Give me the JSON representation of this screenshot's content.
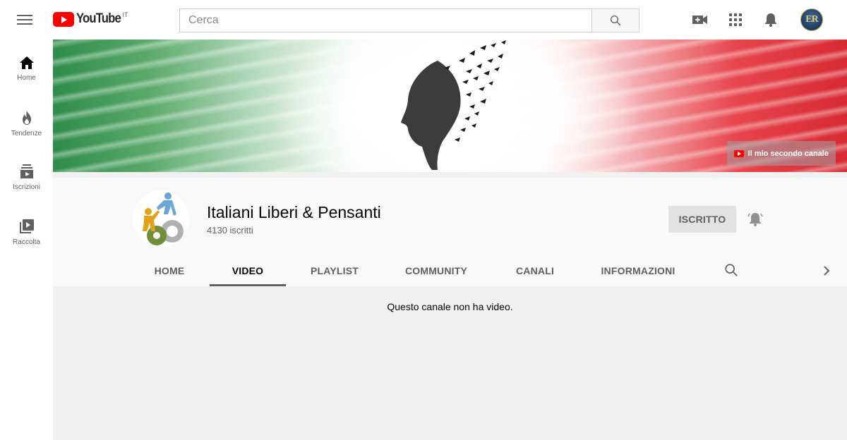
{
  "header": {
    "logo_text": "YouTube",
    "country_code": "IT",
    "search_placeholder": "Cerca"
  },
  "sidebar": {
    "items": [
      {
        "label": "Home",
        "icon": "home-icon"
      },
      {
        "label": "Tendenze",
        "icon": "flame-icon"
      },
      {
        "label": "Iscrizioni",
        "icon": "subscriptions-icon"
      },
      {
        "label": "Raccolta",
        "icon": "library-icon"
      }
    ]
  },
  "banner": {
    "link_label": "Il mio secondo canale"
  },
  "channel": {
    "name": "Italiani Liberi & Pensanti",
    "subscribers": "4130 iscritti",
    "subscribe_label": "ISCRITTO"
  },
  "tabs": [
    "HOME",
    "VIDEO",
    "PLAYLIST",
    "COMMUNITY",
    "CANALI",
    "INFORMAZIONI"
  ],
  "active_tab": "VIDEO",
  "content": {
    "empty_message": "Questo canale non ha video."
  },
  "user": {
    "avatar_initials": "ER"
  },
  "colors": {
    "brand_red": "#ff0000",
    "banner_green": "#2e8b4a",
    "banner_red": "#d72a32"
  }
}
